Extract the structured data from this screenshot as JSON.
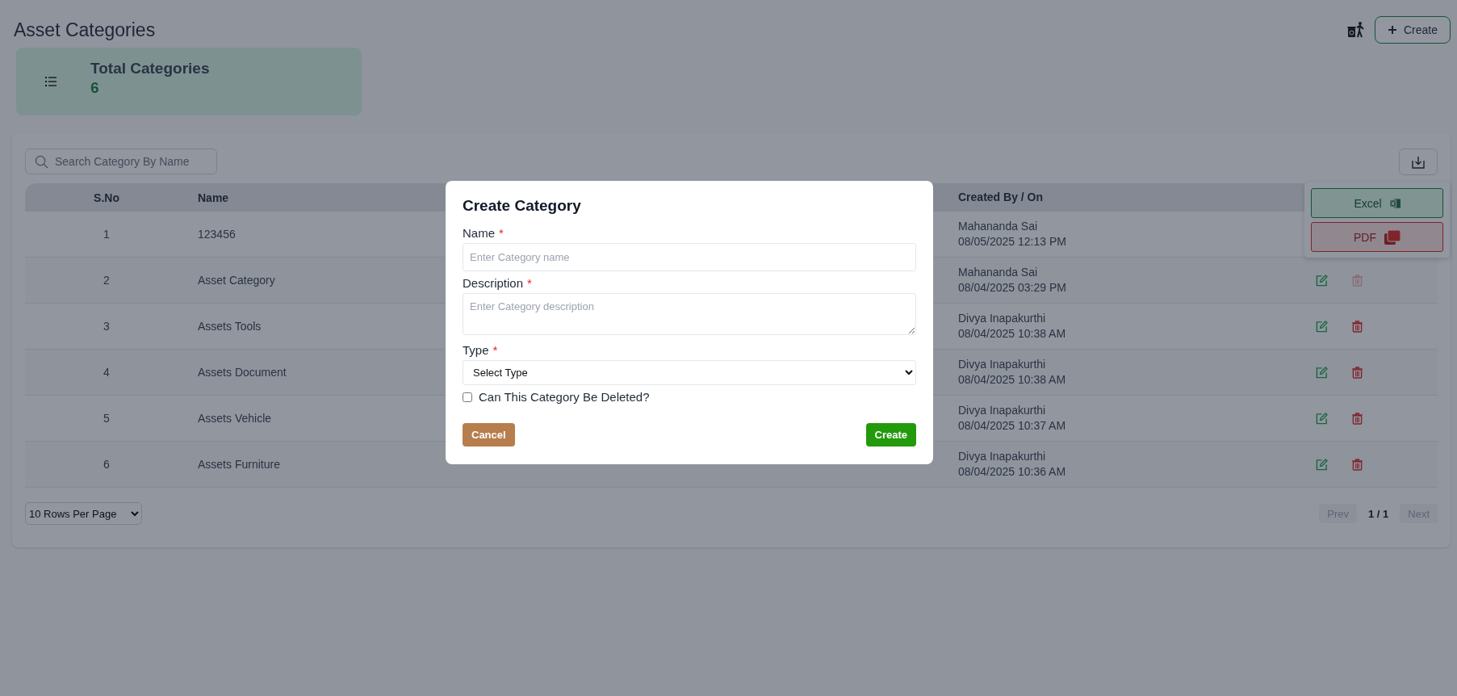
{
  "page": {
    "title": "Asset Categories",
    "create_button": "Create"
  },
  "summary": {
    "label": "Total Categories",
    "value": "6"
  },
  "search": {
    "placeholder": "Search Category By Name"
  },
  "export_menu": {
    "expanded": true,
    "items": [
      {
        "label": "Excel",
        "kind": "excel"
      },
      {
        "label": "PDF",
        "kind": "pdf"
      }
    ]
  },
  "table": {
    "columns": [
      "S.No",
      "Name",
      "Created By / On"
    ],
    "rows": [
      {
        "sno": "1",
        "name": "123456",
        "created_by": "Mahananda Sai",
        "created_on": "08/05/2025 12:13 PM"
      },
      {
        "sno": "2",
        "name": "Asset Category",
        "created_by": "Mahananda Sai",
        "created_on": "08/04/2025 03:29 PM",
        "delete_disabled": true
      },
      {
        "sno": "3",
        "name": "Assets Tools",
        "created_by": "Divya Inapakurthi",
        "created_on": "08/04/2025 10:38 AM",
        "delete_disabled": false
      },
      {
        "sno": "4",
        "name": "Assets Document",
        "created_by": "Divya Inapakurthi",
        "created_on": "08/04/2025 10:38 AM",
        "delete_disabled": false
      },
      {
        "sno": "5",
        "name": "Assets Vehicle",
        "created_by": "Divya Inapakurthi",
        "created_on": "08/04/2025 10:37 AM",
        "delete_disabled": false
      },
      {
        "sno": "6",
        "name": "Assets Furniture",
        "created_by": "Divya Inapakurthi",
        "created_on": "08/04/2025 10:36 AM",
        "delete_disabled": false
      }
    ]
  },
  "pagination": {
    "rows_per_page": "10 Rows Per Page",
    "page": "1 / 1",
    "prev": {
      "label": "Prev",
      "disabled": true
    },
    "next": {
      "label": "Next",
      "disabled": true
    }
  },
  "modal": {
    "title": "Create Category",
    "fields": [
      {
        "kind": "text",
        "label": "Name",
        "required_mark": "*",
        "placeholder": "Enter Category name"
      },
      {
        "kind": "textarea",
        "label": "Description",
        "required_mark": "*",
        "placeholder": "Enter Category description"
      },
      {
        "kind": "select",
        "label": "Type",
        "required_mark": "*",
        "value": "Select Type"
      }
    ],
    "checkbox": {
      "label": "Can This Category Be Deleted?",
      "checked": false
    },
    "cancel": "Cancel",
    "submit": "Create"
  }
}
